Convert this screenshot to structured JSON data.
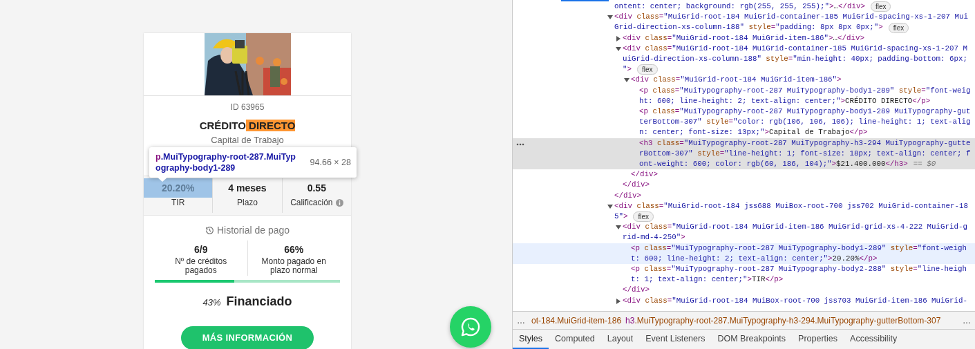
{
  "card": {
    "id_label": "ID 63965",
    "title": [
      {
        "text": "CRÉDITO",
        "highlighted": false
      },
      {
        "text": "DIRECTO",
        "highlighted": true
      }
    ],
    "subtitle": "Capital de Trabajo",
    "stats": [
      {
        "value": "20.20%",
        "label": "TIR",
        "highlighted": true,
        "info": false
      },
      {
        "value": "4 meses",
        "label": "Plazo",
        "highlighted": false,
        "info": false
      },
      {
        "value": "0.55",
        "label": "Calificación",
        "highlighted": false,
        "info": true
      }
    ],
    "history": {
      "title": "Historial de pago",
      "items": [
        {
          "value": "6/9",
          "label": "Nº de créditos pagados"
        },
        {
          "value": "66%",
          "label": "Monto pagado en plazo normal"
        }
      ]
    },
    "funding": {
      "level": 0.43,
      "percent": "43%",
      "label": "Financiado"
    },
    "button": "MÁS INFORMACIÓN"
  },
  "inspect_tooltip": {
    "tag": "p",
    "classes": ".MuiTypography-root-287.MuiTypography-body1-289",
    "size": "94.66 × 28"
  },
  "devtools": {
    "dom_tree": [
      {
        "kind": "fragment",
        "lines": [
          "ontent: center; background: rgb(255, 255, 255);\">…</div>"
        ],
        "badge": "flex",
        "selected": false,
        "hovered": false
      },
      {
        "kind": "element",
        "expanded": true,
        "lines": [
          "<div class=\"MuiGrid-root-184 MuiGrid-container-185 MuiGrid-spacing-xs-1-207 Mui",
          "Grid-direction-xs-column-188\" style=\"padding: 8px 8px 0px;\">"
        ],
        "badge": "flex",
        "selected": false,
        "hovered": false,
        "closing": "</div>",
        "children": [
          {
            "kind": "element",
            "expanded": false,
            "lines": [
              "<div class=\"MuiGrid-root-184 MuiGrid-item-186\">…</div>"
            ],
            "selected": false,
            "hovered": false
          },
          {
            "kind": "element",
            "expanded": true,
            "lines": [
              "<div class=\"MuiGrid-root-184 MuiGrid-container-185 MuiGrid-spacing-xs-1-207 M",
              "uiGrid-direction-xs-column-188\" style=\"min-height: 40px; padding-bottom: 6px;",
              "\">"
            ],
            "badge": "flex",
            "selected": false,
            "hovered": false,
            "closing": "</div>",
            "children": [
              {
                "kind": "element",
                "expanded": true,
                "lines": [
                  "<div class=\"MuiGrid-root-184 MuiGrid-item-186\">"
                ],
                "selected": false,
                "hovered": false,
                "closing": "</div>",
                "children": [
                  {
                    "kind": "leaf",
                    "lines": [
                      "<p class=\"MuiTypography-root-287 MuiTypography-body1-289\" style=\"font-weig",
                      "ht: 600; line-height: 2; text-align: center;\">CRÉDITO DIRECTO</p>"
                    ],
                    "selected": false,
                    "hovered": false
                  },
                  {
                    "kind": "leaf",
                    "lines": [
                      "<p class=\"MuiTypography-root-287 MuiTypography-body1-289 MuiTypography-gut",
                      "terBottom-307\" style=\"color: rgb(106, 106, 106); line-height: 1; text-alig",
                      "n: center; font-size: 13px;\">Capital de Trabajo</p>"
                    ],
                    "selected": false,
                    "hovered": false
                  },
                  {
                    "kind": "leaf",
                    "lines": [
                      "<h3 class=\"MuiTypography-root-287 MuiTypography-h3-294 MuiTypography-gutte",
                      "rBottom-307\" style=\"line-height: 1; font-size: 18px; text-align: center; f",
                      "ont-weight: 600; color: rgb(60, 186, 104);\">$21.400.000</h3>"
                    ],
                    "suffix": "== $0",
                    "selected": true,
                    "hovered": false
                  }
                ]
              }
            ]
          }
        ]
      },
      {
        "kind": "element",
        "expanded": true,
        "lines": [
          "<div class=\"MuiGrid-root-184 jss688 MuiBox-root-700 jss702 MuiGrid-container-18",
          "5\">"
        ],
        "badge": "flex",
        "selected": false,
        "hovered": false,
        "children": [
          {
            "kind": "element",
            "expanded": true,
            "lines": [
              "<div class=\"MuiGrid-root-184 MuiGrid-item-186 MuiGrid-grid-xs-4-222 MuiGrid-g",
              "rid-md-4-250\">"
            ],
            "selected": false,
            "hovered": false,
            "closing": "</div>",
            "children": [
              {
                "kind": "leaf",
                "lines": [
                  "<p class=\"MuiTypography-root-287 MuiTypography-body1-289\" style=\"font-weigh",
                  "t: 600; line-height: 2; text-align: center;\">20.20%</p>"
                ],
                "selected": false,
                "hovered": true
              },
              {
                "kind": "leaf",
                "lines": [
                  "<p class=\"MuiTypography-root-287 MuiTypography-body2-288\" style=\"line-heigh",
                  "t: 1; text-align: center;\">TIR</p>"
                ],
                "selected": false,
                "hovered": false
              }
            ]
          },
          {
            "kind": "element",
            "expanded": false,
            "lines": [
              "<div class=\"MuiGrid-root-184 MuiBox-root-700 jss703 MuiGrid-item-186 MuiGrid-"
            ],
            "selected": false,
            "hovered": false
          }
        ]
      }
    ],
    "breadcrumbs": {
      "overflow_left": "…",
      "overflow_right": "…",
      "items": [
        {
          "classes": "ot-184.MuiGrid-item-186"
        },
        {
          "tag": "h3",
          "classes": ".MuiTypography-root-287.MuiTypography-h3-294.MuiTypography-gutterBottom-307"
        }
      ]
    },
    "tabs": [
      {
        "label": "Styles",
        "selected": true
      },
      {
        "label": "Computed",
        "selected": false
      },
      {
        "label": "Layout",
        "selected": false
      },
      {
        "label": "Event Listeners",
        "selected": false
      },
      {
        "label": "DOM Breakpoints",
        "selected": false
      },
      {
        "label": "Properties",
        "selected": false
      },
      {
        "label": "Accessibility",
        "selected": false
      }
    ]
  }
}
